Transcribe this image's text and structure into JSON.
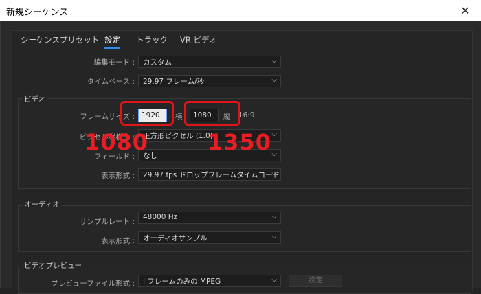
{
  "window": {
    "title": "新規シーケンス",
    "close_glyph": "✕"
  },
  "tabs": [
    {
      "label": "シーケンスプリセット"
    },
    {
      "label": "設定"
    },
    {
      "label": "トラック"
    },
    {
      "label": "VR ビデオ"
    }
  ],
  "settings": {
    "edit_mode": {
      "label": "編集モード :",
      "value": "カスタム"
    },
    "timebase": {
      "label": "タイムベース :",
      "value": "29.97 フレーム/秒"
    }
  },
  "video": {
    "group_label": "ビデオ",
    "frame_size": {
      "label": "フレームサイズ :",
      "width": "1920",
      "width_unit": "横",
      "height": "1080",
      "height_unit": "縦",
      "aspect": "16:9"
    },
    "pixel_aspect": {
      "label": "ピクセル縦横比 :",
      "value": "正方形ピクセル (1.0)"
    },
    "fields": {
      "label": "フィールド :",
      "value": "なし"
    },
    "display_format": {
      "label": "表示形式 :",
      "value": "29.97 fps ドロップフレームタイムコード"
    }
  },
  "audio": {
    "group_label": "オーディオ",
    "sample_rate": {
      "label": "サンプルレート :",
      "value": "48000 Hz"
    },
    "display_format": {
      "label": "表示形式 :",
      "value": "オーディオサンプル"
    }
  },
  "video_preview": {
    "group_label": "ビデオプレビュー",
    "file_format": {
      "label": "プレビューファイル形式 :",
      "value": "I フレームのみの MPEG"
    },
    "settings_button": "設定"
  },
  "annotations": {
    "width_note": "1080",
    "height_note": "1350"
  },
  "colors": {
    "accent": "#2d8ceb",
    "annotation_red": "#e0151c"
  }
}
